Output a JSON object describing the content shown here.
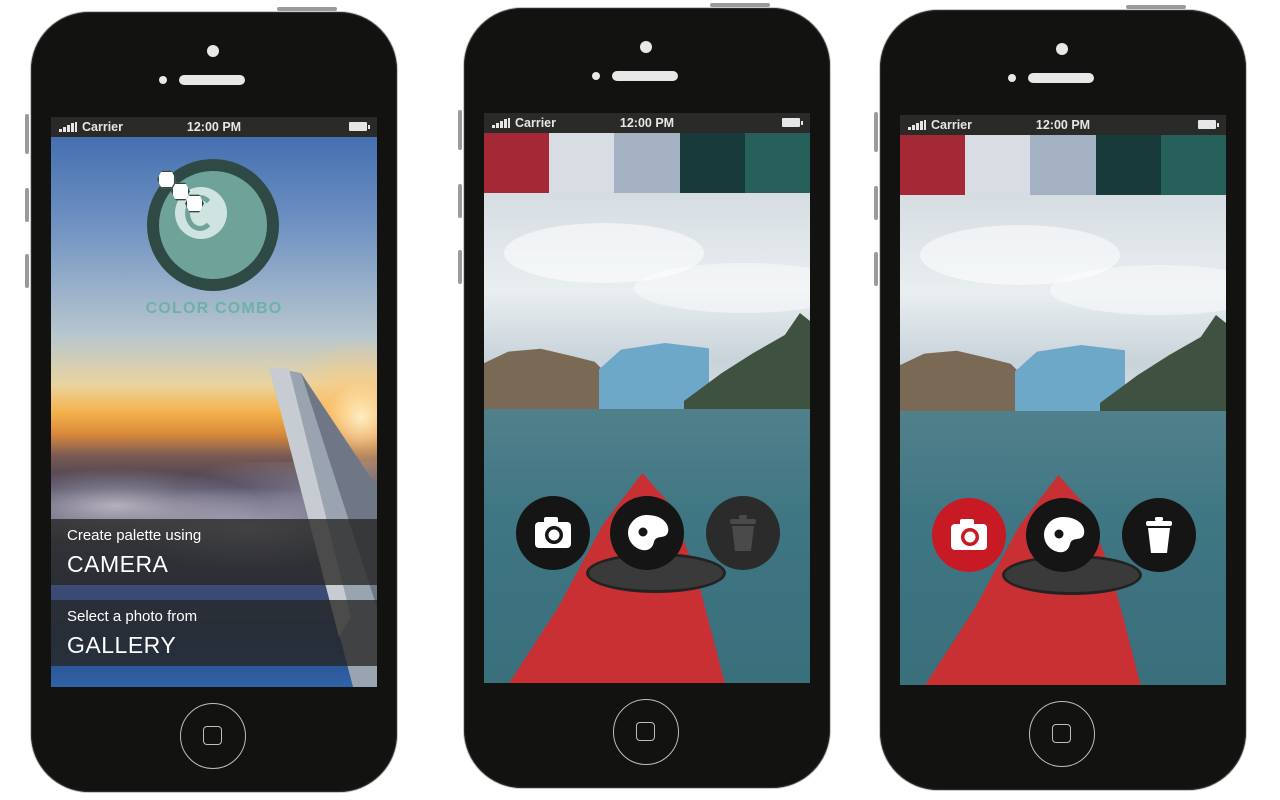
{
  "status_bar": {
    "carrier": "Carrier",
    "time": "12:00 PM"
  },
  "screen1": {
    "app_name": "COLOR COMBO",
    "camera_option": {
      "caption": "Create palette using",
      "label": "CAMERA"
    },
    "gallery_option": {
      "caption": "Select a photo from",
      "label": "GALLERY"
    }
  },
  "palette": {
    "swatches": [
      "#a52836",
      "#d7dde3",
      "#a4b1c2",
      "#183a3b",
      "#275f5a"
    ]
  },
  "screen2": {
    "tools": [
      {
        "icon": "camera-icon",
        "state": "normal"
      },
      {
        "icon": "palette-icon",
        "state": "normal"
      },
      {
        "icon": "trash-icon",
        "state": "disabled"
      }
    ]
  },
  "screen3": {
    "tools": [
      {
        "icon": "camera-icon",
        "state": "active"
      },
      {
        "icon": "palette-icon",
        "state": "normal"
      },
      {
        "icon": "trash-icon",
        "state": "normal"
      }
    ]
  },
  "colors": {
    "accent_red": "#c81a24",
    "logo_teal": "#6fb1a8"
  }
}
